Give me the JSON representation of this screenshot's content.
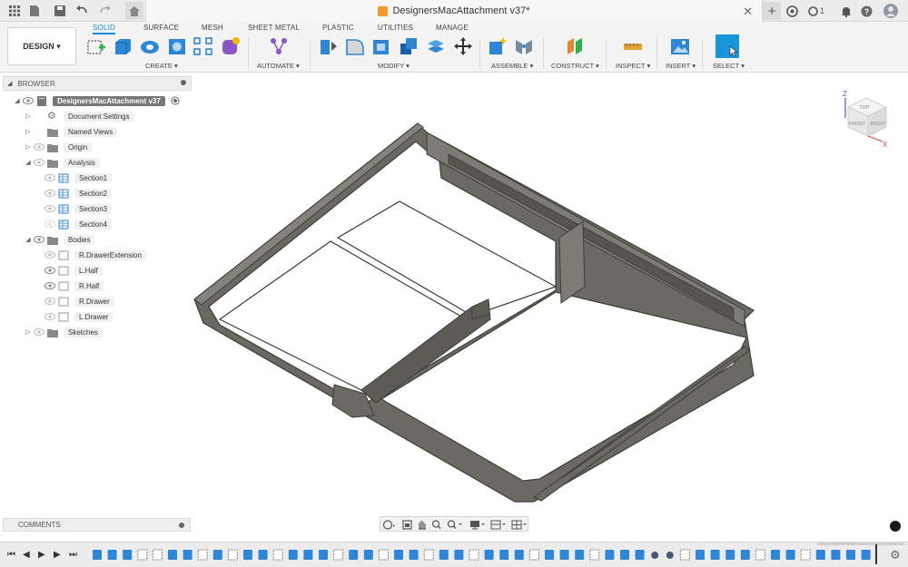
{
  "window": {
    "title": "DesignersMacAttachment v37*",
    "user_count": "1"
  },
  "ribbon": {
    "design_label": "DESIGN ▾",
    "tabs": [
      "SOLID",
      "SURFACE",
      "MESH",
      "SHEET METAL",
      "PLASTIC",
      "UTILITIES",
      "MANAGE"
    ],
    "active_tab": "SOLID",
    "groups": [
      "CREATE ▾",
      "AUTOMATE ▾",
      "MODIFY ▾",
      "ASSEMBLE ▾",
      "CONSTRUCT ▾",
      "INSPECT ▾",
      "INSERT ▾",
      "SELECT ▾"
    ]
  },
  "browser": {
    "header": "BROWSER",
    "root": "DesignersMacAttachment v37",
    "items": {
      "document_settings": "Document Settings",
      "named_views": "Named Views",
      "origin": "Origin",
      "analysis": "Analysis",
      "section1": "Section1",
      "section2": "Section2",
      "section3": "Section3",
      "section4": "Section4",
      "bodies": "Bodies",
      "r_drawer_extension": "R.DrawerExtension",
      "l_half": "L.Half",
      "r_half": "R.Half",
      "r_drawer": "R.Drawer",
      "l_drawer": "L.Drawer",
      "sketches": "Sketches"
    }
  },
  "comments": {
    "label": "COMMENTS"
  },
  "viewcube": {
    "top": "TOP",
    "front": "FRONT",
    "right": "RIGHT",
    "z_axis": "Z",
    "x_axis": "X"
  },
  "icons": [
    "file-icon",
    "save-icon",
    "undo-icon",
    "redo-icon",
    "home-icon",
    "add-tab-icon",
    "extensions-icon",
    "job-status-icon",
    "notifications-icon",
    "help-icon",
    "profile-avatar-icon",
    "select-cursor-icon",
    "settings-gear-icon"
  ],
  "colors": {
    "accent": "#1a8ad8",
    "model": "#6b6a62",
    "model_edge": "#3d3c36",
    "active_select": "#1b95d9"
  }
}
